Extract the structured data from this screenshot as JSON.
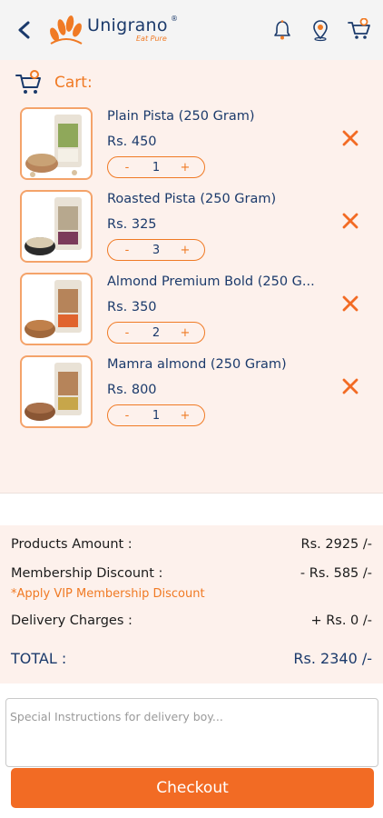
{
  "header": {
    "logo_text": "Unigrano",
    "logo_reg": "®",
    "logo_tagline": "Eat Pure",
    "icons": [
      "back-icon",
      "notification-bell-icon",
      "location-pin-icon",
      "cart-icon"
    ]
  },
  "cart": {
    "title": "Cart:",
    "items": [
      {
        "name": "Plain Pista (250 Gram)",
        "price": "Rs. 450",
        "qty": "1",
        "minus": "-",
        "plus": "+"
      },
      {
        "name": "Roasted Pista (250 Gram)",
        "price": "Rs. 325",
        "qty": "3",
        "minus": "-",
        "plus": "+"
      },
      {
        "name": "Almond Premium Bold  (250 G...",
        "price": "Rs. 350",
        "qty": "2",
        "minus": "-",
        "plus": "+"
      },
      {
        "name": "Mamra almond (250 Gram)",
        "price": "Rs. 800",
        "qty": "1",
        "minus": "-",
        "plus": "+"
      }
    ]
  },
  "summary": {
    "products_label": "Products Amount :",
    "products_value": "Rs. 2925 /-",
    "membership_label": "Membership Discount :",
    "membership_value": "- Rs. 585 /-",
    "vip_note": "*Apply VIP Membership Discount",
    "delivery_label": "Delivery Charges :",
    "delivery_value": "+ Rs. 0 /-",
    "total_label": "TOTAL :",
    "total_value": "Rs. 2340 /-"
  },
  "instructions": {
    "placeholder": "Special Instructions for delivery boy...",
    "value": ""
  },
  "checkout_label": "Checkout",
  "colors": {
    "accent": "#f26b24",
    "navy": "#1b3a6b",
    "cart_bg": "#fdf1ec",
    "header_bg": "#f4f4f4"
  }
}
